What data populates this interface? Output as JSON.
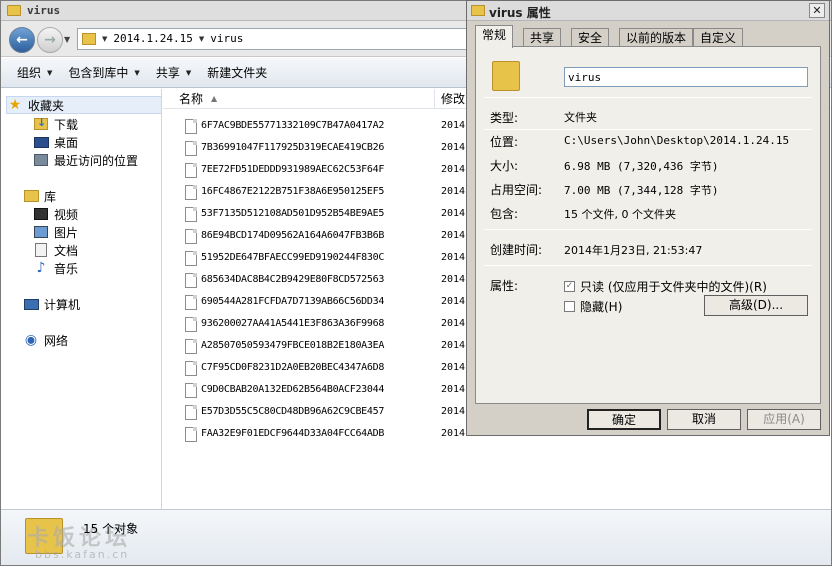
{
  "explorer": {
    "title": "virus",
    "address": {
      "crumbs": [
        "2014.1.24.15",
        "virus"
      ]
    },
    "toolbar": {
      "organize": "组织",
      "include_in_library": "包含到库中",
      "share": "共享",
      "new_folder": "新建文件夹"
    },
    "sidebar": {
      "favorites": "收藏夹",
      "downloads": "下载",
      "desktop": "桌面",
      "recent": "最近访问的位置",
      "libraries": "库",
      "videos": "视频",
      "pictures": "图片",
      "documents": "文档",
      "music": "音乐",
      "computer": "计算机",
      "network": "网络"
    },
    "columns": {
      "name": "名称",
      "date": "修改"
    },
    "files": [
      {
        "name": "6F7AC9BDE55771332109C7B47A0417A2",
        "date": "2014"
      },
      {
        "name": "7B36991047F117925D319ECAE419CB26",
        "date": "2014"
      },
      {
        "name": "7EE72FD51DEDDD931989AEC62C53F64F",
        "date": "2014"
      },
      {
        "name": "16FC4867E2122B751F38A6E950125EF5",
        "date": "2014"
      },
      {
        "name": "53F7135D512108AD501D952B54BE9AE5",
        "date": "2014"
      },
      {
        "name": "86E94BCD174D09562A164A6047FB3B6B",
        "date": "2014"
      },
      {
        "name": "51952DE647BFAECC99ED9190244F830C",
        "date": "2014"
      },
      {
        "name": "685634DAC8B4C2B9429E80F8CD572563",
        "date": "2014"
      },
      {
        "name": "690544A281FCFDA7D7139AB66C56DD34",
        "date": "2014"
      },
      {
        "name": "936200027AA41A5441E3F863A36F9968",
        "date": "2014"
      },
      {
        "name": "A28507050593479FBCE018B2E180A3EA",
        "date": "2014"
      },
      {
        "name": "C7F95CD0F8231D2A0EB20BEC4347A6D8",
        "date": "2014"
      },
      {
        "name": "C9D0CBAB20A132ED62B564B0ACF23044",
        "date": "2014"
      },
      {
        "name": "E57D3D55C5C80CD48DB96A62C9CBE457",
        "date": "2014"
      },
      {
        "name": "FAA32E9F01EDCF9644D33A04FCC64ADB",
        "date": "2014"
      }
    ],
    "status": {
      "count": "15 个对象"
    },
    "watermark": {
      "text": "卡饭论坛",
      "url": "bbs.kafan.cn"
    }
  },
  "props": {
    "title": "virus 属性",
    "tabs": [
      "常规",
      "共享",
      "安全",
      "以前的版本",
      "自定义"
    ],
    "name_value": "virus",
    "rows": {
      "type_label": "类型:",
      "type_value": "文件夹",
      "location_label": "位置:",
      "location_value": "C:\\Users\\John\\Desktop\\2014.1.24.15",
      "size_label": "大小:",
      "size_value": "6.98 MB (7,320,436 字节)",
      "disk_label": "占用空间:",
      "disk_value": "7.00 MB (7,344,128 字节)",
      "contains_label": "包含:",
      "contains_value": "15 个文件, 0 个文件夹",
      "created_label": "创建时间:",
      "created_value": "2014年1月23日, 21:53:47",
      "attr_label": "属性:"
    },
    "attrs": {
      "readonly": "只读 (仅应用于文件夹中的文件)(R)",
      "hidden": "隐藏(H)",
      "advanced": "高级(D)..."
    },
    "buttons": {
      "ok": "确定",
      "cancel": "取消",
      "apply": "应用(A)"
    }
  }
}
